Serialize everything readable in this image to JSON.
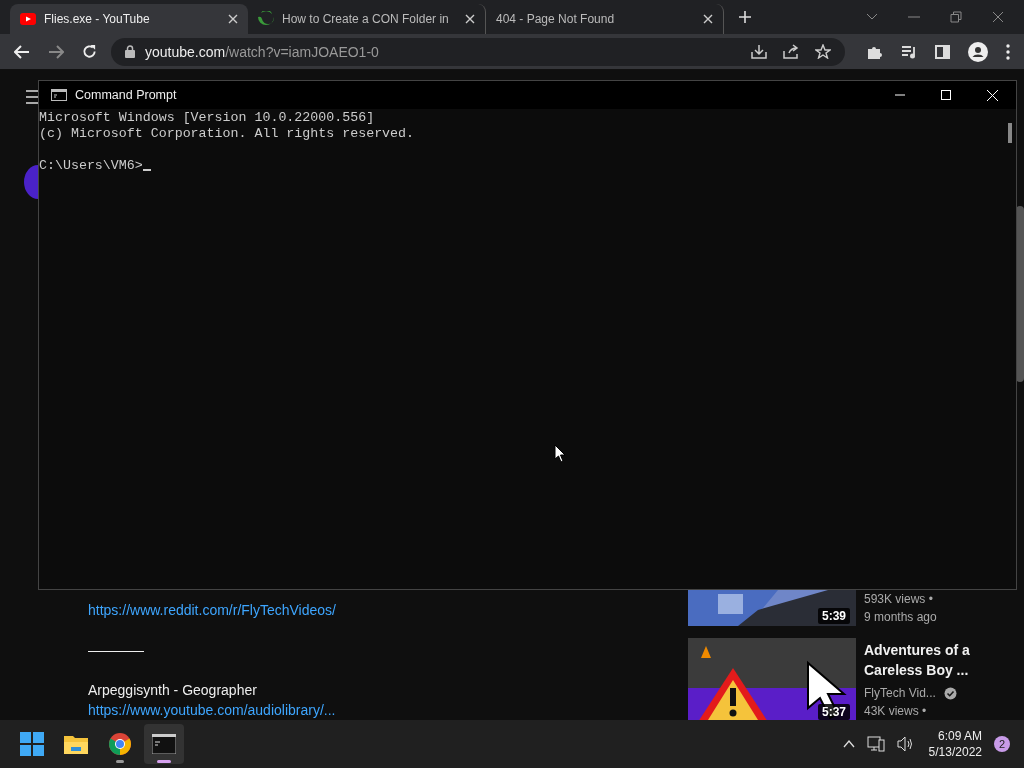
{
  "browser": {
    "tabs": [
      {
        "title": "Flies.exe - YouTube",
        "selected": true,
        "kind": "youtube"
      },
      {
        "title": "How to Create a CON Folder in",
        "selected": false,
        "kind": "site"
      },
      {
        "title": "404 - Page Not Found",
        "selected": false,
        "kind": "blank"
      }
    ],
    "address": {
      "domain": "youtube.com",
      "path": "/watch?v=iamJOAEO1-0"
    }
  },
  "description": [
    {
      "kind": "link",
      "text": "https://www.reddit.com/r/FlyTechVideos/"
    },
    {
      "kind": "gap"
    },
    {
      "kind": "text",
      "text": "————"
    },
    {
      "kind": "gap"
    },
    {
      "kind": "text",
      "text": "Arpeggisynth - Geographer"
    },
    {
      "kind": "link",
      "text": "https://www.youtube.com/audiolibrary/..."
    }
  ],
  "related": [
    {
      "duration": "5:39",
      "meta": [
        "593K views •",
        "9 months ago"
      ]
    },
    {
      "duration": "5:37",
      "title": "Adventures of a Careless Boy ...",
      "channel": "FlyTech Vid...",
      "verified": true,
      "meta": [
        "43K views •"
      ]
    }
  ],
  "cmd": {
    "title": "Command Prompt",
    "output": [
      "Microsoft Windows [Version 10.0.22000.556]",
      "(c) Microsoft Corporation. All rights reserved."
    ],
    "prompt": "C:\\Users\\VM6>"
  },
  "taskbar": {
    "apps": [
      {
        "kind": "start",
        "running": false,
        "selected": false
      },
      {
        "kind": "explorer",
        "running": false,
        "selected": false
      },
      {
        "kind": "chrome",
        "running": true,
        "selected": false
      },
      {
        "kind": "terminal",
        "running": true,
        "selected": true
      }
    ],
    "time": "6:09 AM",
    "date": "5/13/2022",
    "notifications": "2"
  }
}
